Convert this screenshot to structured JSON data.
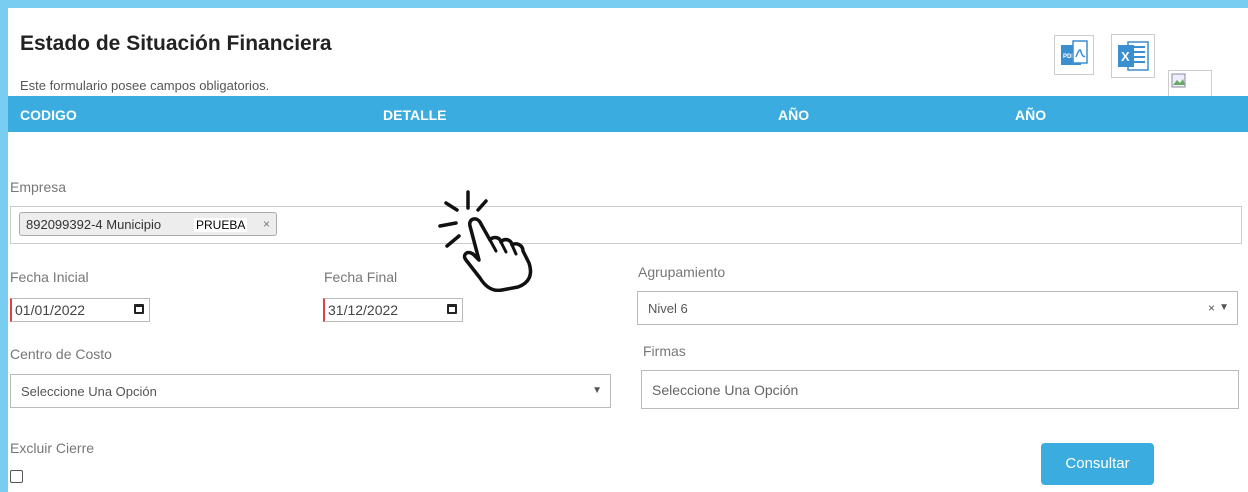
{
  "header": {
    "title": "Estado de Situación Financiera",
    "subtitle": "Este formulario posee campos obligatorios.",
    "pdf_icon": "pdf-icon",
    "excel_icon": "excel-icon"
  },
  "table": {
    "columns": [
      "CODIGO",
      "DETALLE",
      "AÑO",
      "AÑO"
    ]
  },
  "form": {
    "empresa_label": "Empresa",
    "empresa_chip": "892099392-4 Municipio",
    "empresa_chip_overlay": "PRUEBA",
    "empresa_chip_remove": "×",
    "fecha_inicial_label": "Fecha Inicial",
    "fecha_inicial_value": "01/01/2022",
    "fecha_final_label": "Fecha Final",
    "fecha_final_value": "31/12/2022",
    "agrupamiento_label": "Agrupamiento",
    "agrupamiento_value": "Nivel 6",
    "centro_costo_label": "Centro de Costo",
    "centro_costo_placeholder": "Seleccione Una Opción",
    "firmas_label": "Firmas",
    "firmas_placeholder": "Seleccione Una Opción",
    "excluir_cierre_label": "Excluir Cierre",
    "excluir_cierre_checked": false,
    "consultar_label": "Consultar"
  },
  "colors": {
    "accent": "#3aace0",
    "border_frame": "#78cdf0",
    "required": "#e04040"
  },
  "cursor": {
    "icon": "pointer-hand-click-icon"
  }
}
